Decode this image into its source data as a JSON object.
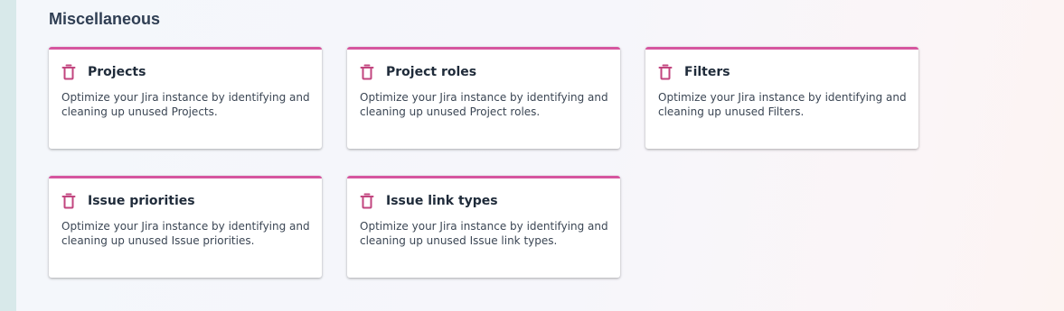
{
  "section": {
    "title": "Miscellaneous"
  },
  "theme": {
    "accent": "#d6569f",
    "icon_color": "#c2457f"
  },
  "cards": [
    {
      "title": "Projects",
      "icon": "trash-icon",
      "description": "Optimize your Jira instance by identifying and cleaning up unused Projects."
    },
    {
      "title": "Project roles",
      "icon": "trash-icon",
      "description": "Optimize your Jira instance by identifying and cleaning up unused Project roles."
    },
    {
      "title": "Filters",
      "icon": "trash-icon",
      "description": "Optimize your Jira instance by identifying and cleaning up unused Filters."
    },
    {
      "title": "Issue priorities",
      "icon": "trash-icon",
      "description": "Optimize your Jira instance by identifying and cleaning up unused Issue priorities."
    },
    {
      "title": "Issue link types",
      "icon": "trash-icon",
      "description": "Optimize your Jira instance by identifying and cleaning up unused Issue link types."
    }
  ]
}
